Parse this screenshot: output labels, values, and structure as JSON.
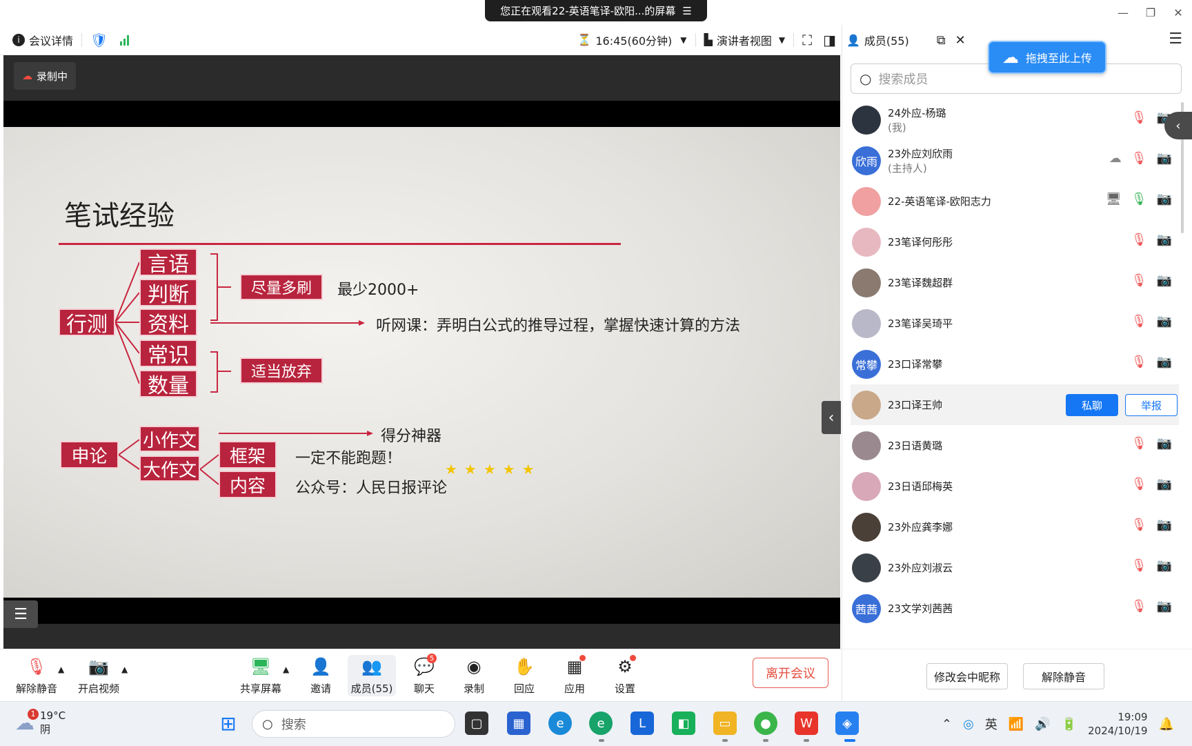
{
  "banner": {
    "text": "您正在观看22-英语笔译-欧阳...的屏幕",
    "icon": "menu-icon"
  },
  "topbar": {
    "meeting_details": "会议详情",
    "timer": "16:45(60分钟)",
    "view_mode": "演讲者视图"
  },
  "video": {
    "recording_label": "录制中",
    "slide": {
      "title": "笔试经验",
      "xingce": "行测",
      "categories": [
        "言语",
        "判断",
        "资料",
        "常识",
        "数量"
      ],
      "tag_practice": "尽量多刷",
      "practice_note": "最少2000+",
      "course_note": "听网课：弄明白公式的推导过程，掌握快速计算的方法",
      "tag_give_up": "适当放弃",
      "shenlun": "申论",
      "small_essay": "小作文",
      "big_essay": "大作文",
      "frame": "框架",
      "content": "内容",
      "score_tool": "得分神器",
      "stars": "★★★★★",
      "frame_note": "一定不能跑题！",
      "content_note": "公众号：人民日报评论"
    }
  },
  "bottombar": {
    "unmute": "解除静音",
    "start_video": "开启视频",
    "share_screen": "共享屏幕",
    "invite": "邀请",
    "members": "成员(55)",
    "chat": "聊天",
    "chat_badge": "5",
    "record": "录制",
    "reactions": "回应",
    "apps": "应用",
    "settings": "设置",
    "leave": "离开会议"
  },
  "panel": {
    "title": "成员(55)",
    "upload_label": "拖拽至此上传",
    "search_placeholder": "搜索成员",
    "members": [
      {
        "name": "24外应-杨璐",
        "role": "(我)",
        "avatar_text": "",
        "avatar_color": "#2c3440"
      },
      {
        "name": "23外应刘欣雨",
        "role": "(主持人)",
        "avatar_text": "欣雨",
        "avatar_color": "#3a6fd8"
      },
      {
        "name": "22-英语笔译-欧阳志力",
        "role": "",
        "avatar_text": "",
        "avatar_color": "#f0a0a0"
      },
      {
        "name": "23笔译何彤彤",
        "role": "",
        "avatar_text": "",
        "avatar_color": "#e8b8c0"
      },
      {
        "name": "23笔译魏超群",
        "role": "",
        "avatar_text": "",
        "avatar_color": "#8a7a70"
      },
      {
        "name": "23笔译吴琦平",
        "role": "",
        "avatar_text": "",
        "avatar_color": "#b8b8c8"
      },
      {
        "name": "23口译常攀",
        "role": "",
        "avatar_text": "常攀",
        "avatar_color": "#3a6fd8"
      },
      {
        "name": "23口译王帅",
        "role": "",
        "avatar_text": "",
        "avatar_color": "#c9a88a"
      },
      {
        "name": "23日语黄璐",
        "role": "",
        "avatar_text": "",
        "avatar_color": "#9a8a90"
      },
      {
        "name": "23日语邱梅英",
        "role": "",
        "avatar_text": "",
        "avatar_color": "#d8a8b8"
      },
      {
        "name": "23外应龚李娜",
        "role": "",
        "avatar_text": "",
        "avatar_color": "#4a4038"
      },
      {
        "name": "23外应刘淑云",
        "role": "",
        "avatar_text": "",
        "avatar_color": "#3a4048"
      },
      {
        "name": "23文学刘茜茜",
        "role": "",
        "avatar_text": "茜茜",
        "avatar_color": "#3a6fd8"
      }
    ],
    "private_chat": "私聊",
    "report": "举报",
    "rename": "修改会中昵称",
    "unmute_member": "解除静音"
  },
  "taskbar": {
    "weather_temp": "19°C",
    "weather_desc": "阴",
    "weather_badge": "1",
    "search_placeholder": "搜索",
    "ime": "英",
    "time": "19:09",
    "date": "2024/10/19"
  }
}
